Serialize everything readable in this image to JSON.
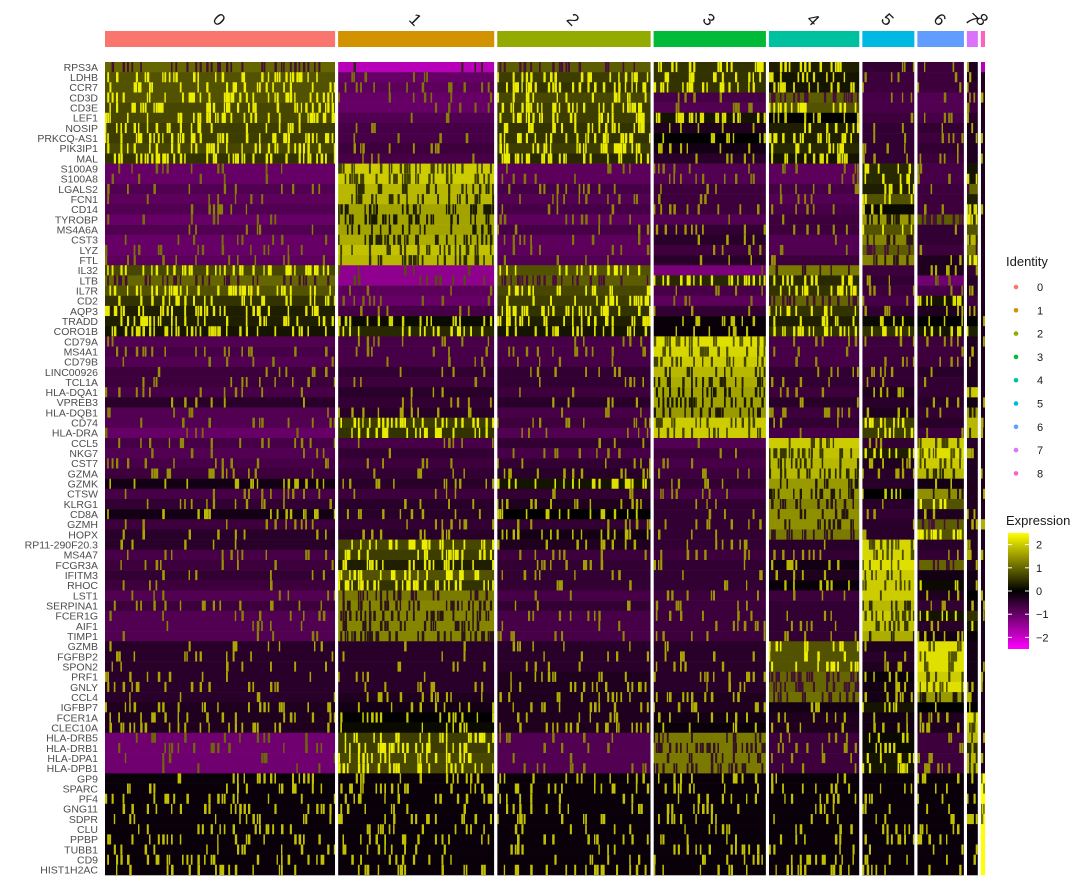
{
  "chart_data": {
    "type": "heatmap",
    "title": "",
    "xlabel": "",
    "ylabel": "",
    "clusters": [
      {
        "name": "0",
        "color": "#F8766D",
        "cells": 840
      },
      {
        "name": "1",
        "color": "#D39200",
        "cells": 570
      },
      {
        "name": "2",
        "color": "#93AA00",
        "cells": 560
      },
      {
        "name": "3",
        "color": "#00BA38",
        "cells": 410
      },
      {
        "name": "4",
        "color": "#00C19F",
        "cells": 330
      },
      {
        "name": "5",
        "color": "#00B9E3",
        "cells": 190
      },
      {
        "name": "6",
        "color": "#619CFF",
        "cells": 170
      },
      {
        "name": "7",
        "color": "#DB72FB",
        "cells": 40
      },
      {
        "name": "8",
        "color": "#FF61C3",
        "cells": 15
      }
    ],
    "genes": [
      "RPS3A",
      "LDHB",
      "CCR7",
      "CD3D",
      "CD3E",
      "LEF1",
      "NOSIP",
      "PRKCQ-AS1",
      "PIK3IP1",
      "MAL",
      "S100A9",
      "S100A8",
      "LGALS2",
      "FCN1",
      "CD14",
      "TYROBP",
      "MS4A6A",
      "CST3",
      "LYZ",
      "FTL",
      "IL32",
      "LTB",
      "IL7R",
      "CD2",
      "AQP3",
      "TRADD",
      "CORO1B",
      "CD79A",
      "MS4A1",
      "CD79B",
      "LINC00926",
      "TCL1A",
      "HLA-DQA1",
      "VPREB3",
      "HLA-DQB1",
      "CD74",
      "HLA-DRA",
      "CCL5",
      "NKG7",
      "CST7",
      "GZMA",
      "GZMK",
      "CTSW",
      "KLRG1",
      "CD8A",
      "GZMH",
      "HOPX",
      "RP11-290F20.3",
      "MS4A7",
      "FCGR3A",
      "IFITM3",
      "RHOC",
      "LST1",
      "SERPINA1",
      "FCER1G",
      "AIF1",
      "TIMP1",
      "GZMB",
      "FGFBP2",
      "SPON2",
      "PRF1",
      "GNLY",
      "CCL4",
      "IGFBP7",
      "FCER1A",
      "CLEC10A",
      "HLA-DRB5",
      "HLA-DRB1",
      "HLA-DPA1",
      "HLA-DPB1",
      "GP9",
      "SPARC",
      "PF4",
      "GNG11",
      "SDPR",
      "CLU",
      "PPBP",
      "TUBB1",
      "CD9",
      "HIST1H2AC"
    ],
    "mean_expression": {
      "0": [
        1.0,
        0.8,
        0.8,
        0.8,
        0.7,
        0.7,
        0.6,
        0.6,
        0.7,
        0.5,
        -1.0,
        -1.0,
        -0.8,
        -0.9,
        -0.8,
        -1.0,
        -0.8,
        -1.0,
        -1.0,
        -0.9,
        0.7,
        1.0,
        0.8,
        0.5,
        0.3,
        0.3,
        0.2,
        -0.8,
        -0.7,
        -0.8,
        -0.6,
        -0.6,
        -0.7,
        -0.4,
        -0.8,
        -0.8,
        -1.0,
        -0.7,
        -0.8,
        -0.7,
        -0.6,
        -0.2,
        -0.7,
        -0.5,
        -0.2,
        -0.6,
        -0.4,
        -0.4,
        -0.7,
        -0.6,
        -0.5,
        -0.6,
        -0.8,
        -0.6,
        -0.8,
        -0.8,
        -0.8,
        -0.4,
        -0.4,
        -0.4,
        -0.4,
        -0.4,
        -0.4,
        -0.3,
        -0.3,
        -0.3,
        -1.1,
        -1.1,
        -1.1,
        -1.1,
        -0.1,
        -0.1,
        -0.1,
        -0.1,
        -0.1,
        -0.1,
        -0.1,
        -0.1,
        -0.1,
        -0.1
      ],
      "1": [
        -1.8,
        -1.0,
        -0.9,
        -1.0,
        -1.0,
        -0.8,
        -0.7,
        -0.7,
        -0.6,
        -0.7,
        2.0,
        2.0,
        1.8,
        1.8,
        1.6,
        1.6,
        1.6,
        1.7,
        1.9,
        1.8,
        -1.4,
        -1.4,
        -0.9,
        -1.0,
        -0.7,
        0.1,
        0.4,
        -0.7,
        -0.7,
        -0.7,
        -0.5,
        -0.6,
        -0.4,
        -0.5,
        -0.4,
        0.6,
        0.5,
        -0.7,
        -0.5,
        -0.6,
        -0.5,
        -0.4,
        -0.6,
        -0.4,
        -0.4,
        -0.5,
        -0.4,
        0.7,
        0.6,
        0.3,
        0.8,
        0.5,
        1.2,
        1.3,
        1.3,
        1.3,
        1.3,
        -0.4,
        -0.4,
        -0.4,
        -0.4,
        -0.4,
        -0.3,
        -0.2,
        0.0,
        0.1,
        0.6,
        0.6,
        0.7,
        0.7,
        -0.1,
        -0.1,
        -0.1,
        -0.1,
        -0.1,
        -0.1,
        -0.1,
        -0.1,
        -0.1,
        -0.1
      ],
      "2": [
        0.9,
        0.6,
        0.5,
        0.7,
        0.6,
        0.6,
        0.5,
        0.5,
        0.6,
        0.4,
        -0.9,
        -0.9,
        -0.7,
        -0.8,
        -0.7,
        -0.9,
        -0.7,
        -0.9,
        -0.9,
        -0.8,
        0.8,
        0.9,
        0.7,
        0.6,
        0.5,
        0.3,
        0.2,
        -0.7,
        -0.7,
        -0.7,
        -0.5,
        -0.5,
        -0.6,
        -0.4,
        -0.7,
        -0.6,
        -0.8,
        -0.5,
        -0.7,
        -0.5,
        -0.4,
        0.2,
        -0.5,
        -0.3,
        0.0,
        -0.5,
        -0.2,
        -0.3,
        -0.6,
        -0.5,
        -0.5,
        -0.5,
        -0.7,
        -0.5,
        -0.7,
        -0.7,
        -0.7,
        -0.4,
        -0.4,
        -0.4,
        -0.3,
        -0.3,
        -0.3,
        -0.3,
        -0.3,
        -0.3,
        -0.8,
        -0.8,
        -0.8,
        -0.8,
        -0.1,
        -0.1,
        -0.1,
        -0.1,
        -0.1,
        -0.1,
        -0.1,
        -0.1,
        -0.1,
        -0.1
      ],
      "3": [
        0.5,
        0.5,
        0.5,
        -0.7,
        -0.8,
        0.2,
        -0.3,
        0.0,
        -0.2,
        -0.4,
        -0.8,
        -0.8,
        -0.6,
        -0.6,
        -0.6,
        -0.8,
        -0.5,
        -0.4,
        -0.6,
        -0.4,
        -1.2,
        0.4,
        -0.7,
        -0.9,
        -0.5,
        -0.1,
        -0.1,
        2.2,
        2.1,
        2.0,
        1.8,
        1.7,
        1.6,
        1.6,
        1.5,
        2.0,
        2.0,
        -0.8,
        -0.6,
        -0.7,
        -0.6,
        -0.5,
        -0.7,
        -0.5,
        -0.5,
        -0.5,
        -0.5,
        -0.5,
        -0.6,
        -0.5,
        -0.5,
        -0.5,
        -0.6,
        -0.6,
        -0.6,
        -0.6,
        -0.6,
        -0.4,
        -0.4,
        -0.4,
        -0.4,
        -0.4,
        -0.3,
        -0.3,
        -0.2,
        -0.1,
        1.2,
        1.2,
        1.2,
        1.2,
        -0.1,
        -0.1,
        -0.1,
        -0.1,
        -0.1,
        -0.1,
        -0.1,
        -0.1,
        -0.1,
        -0.1
      ],
      "4": [
        0.3,
        0.2,
        0.2,
        0.9,
        0.8,
        0.0,
        0.3,
        0.3,
        0.4,
        0.2,
        -0.9,
        -0.9,
        -0.7,
        -0.8,
        -0.7,
        -0.6,
        -0.6,
        -0.8,
        -0.8,
        -0.6,
        1.2,
        0.4,
        0.5,
        1.0,
        0.5,
        0.3,
        0.5,
        -0.7,
        -0.7,
        -0.7,
        -0.5,
        -0.5,
        -0.6,
        -0.4,
        -0.6,
        -0.5,
        -0.7,
        2.0,
        1.9,
        1.8,
        1.8,
        1.5,
        1.5,
        1.3,
        1.4,
        1.4,
        1.2,
        -0.4,
        -0.5,
        -0.2,
        -0.3,
        -0.1,
        -0.6,
        -0.5,
        -0.5,
        -0.5,
        -0.5,
        0.8,
        0.8,
        0.8,
        1.0,
        1.0,
        1.1,
        -0.2,
        -0.3,
        -0.3,
        -0.6,
        -0.6,
        -0.6,
        -0.6,
        -0.1,
        -0.1,
        -0.1,
        -0.1,
        -0.1,
        -0.1,
        -0.1,
        -0.1,
        -0.1,
        -0.1
      ],
      "5": [
        -0.5,
        -0.6,
        -0.6,
        -0.7,
        -0.7,
        -0.6,
        -0.5,
        -0.5,
        -0.5,
        -0.5,
        0.4,
        0.4,
        0.3,
        0.8,
        0.1,
        1.5,
        0.8,
        1.3,
        0.9,
        1.3,
        -0.6,
        -0.5,
        -0.6,
        -0.7,
        -0.5,
        0.1,
        0.5,
        -0.6,
        -0.6,
        -0.6,
        -0.5,
        -0.5,
        -0.3,
        -0.4,
        -0.3,
        0.6,
        0.6,
        -0.5,
        0.3,
        -0.3,
        -0.4,
        -0.4,
        0.0,
        -0.4,
        -0.5,
        -0.4,
        -0.4,
        2.1,
        2.1,
        2.2,
        2.0,
        2.0,
        2.0,
        1.8,
        2.0,
        1.9,
        1.7,
        -0.3,
        -0.4,
        -0.3,
        -0.1,
        -0.2,
        -0.2,
        0.2,
        -0.2,
        -0.2,
        0.1,
        0.1,
        0.2,
        0.2,
        -0.1,
        -0.1,
        -0.1,
        -0.1,
        -0.1,
        -0.1,
        -0.1,
        -0.1,
        -0.1,
        -0.1
      ],
      "6": [
        -0.6,
        -0.6,
        -0.6,
        -0.8,
        -0.8,
        -0.7,
        -0.5,
        -0.6,
        -0.5,
        -0.6,
        -0.7,
        -0.7,
        -0.6,
        -0.6,
        -0.6,
        0.9,
        -0.5,
        -0.5,
        -0.6,
        -0.3,
        -0.3,
        -1.1,
        -0.7,
        0.2,
        -0.3,
        0.0,
        0.2,
        -0.6,
        -0.6,
        -0.6,
        -0.4,
        -0.5,
        -0.5,
        -0.4,
        -0.5,
        -0.4,
        -0.6,
        2.0,
        2.2,
        2.0,
        1.8,
        -0.2,
        1.4,
        0.8,
        -0.3,
        0.9,
        0.8,
        -0.4,
        -0.5,
        1.0,
        -0.2,
        0.1,
        -0.3,
        -0.5,
        0.2,
        -0.4,
        -0.2,
        2.2,
        2.2,
        2.2,
        2.0,
        2.2,
        1.5,
        0.0,
        -0.3,
        -0.3,
        -0.6,
        -0.6,
        -0.6,
        -0.6,
        -0.1,
        -0.1,
        -0.1,
        -0.1,
        -0.1,
        -0.1,
        -0.1,
        -0.1,
        -0.1,
        -0.1
      ],
      "7": [
        -0.3,
        -0.3,
        -0.4,
        -0.6,
        -0.6,
        -0.4,
        -0.3,
        -0.3,
        -0.3,
        -0.3,
        0.2,
        0.2,
        1.0,
        0.3,
        0.2,
        0.5,
        0.8,
        1.8,
        1.2,
        0.8,
        -0.5,
        -0.4,
        -0.4,
        -0.6,
        -0.3,
        0.0,
        0.3,
        -0.3,
        -0.3,
        -0.3,
        -0.3,
        -0.3,
        2.0,
        -0.2,
        1.5,
        1.8,
        1.8,
        -0.4,
        -0.3,
        -0.3,
        -0.3,
        -0.3,
        -0.3,
        -0.3,
        -0.3,
        -0.3,
        -0.3,
        -0.3,
        -0.3,
        -0.3,
        -0.2,
        -0.2,
        0.0,
        -0.2,
        0.5,
        0.2,
        -0.1,
        -0.2,
        -0.2,
        -0.2,
        -0.2,
        -0.2,
        -0.2,
        0.0,
        2.2,
        2.0,
        1.8,
        1.8,
        1.8,
        1.8,
        -0.1,
        -0.1,
        -0.1,
        -0.1,
        -0.1,
        -0.1,
        -0.1,
        -0.1,
        -0.1,
        -0.1
      ],
      "8": [
        -1.8,
        -0.3,
        -0.3,
        -0.3,
        -0.3,
        -0.3,
        -0.3,
        -0.3,
        -0.3,
        -0.3,
        -0.3,
        -0.3,
        -0.3,
        -0.3,
        -0.3,
        -0.3,
        -0.3,
        -0.3,
        -0.3,
        -0.3,
        -0.3,
        -0.3,
        -0.3,
        -0.3,
        -0.3,
        -0.3,
        -0.3,
        -0.3,
        -0.3,
        -0.3,
        -0.3,
        -0.3,
        -0.3,
        -0.3,
        -0.3,
        -0.3,
        -0.3,
        -0.3,
        -0.3,
        -0.3,
        -0.3,
        -0.3,
        -0.3,
        -0.3,
        -0.3,
        -0.3,
        -0.3,
        -0.3,
        -0.3,
        -0.3,
        -0.3,
        -0.3,
        -0.3,
        -0.3,
        -0.3,
        -0.3,
        -0.3,
        -0.3,
        -0.3,
        -0.3,
        -0.3,
        -0.3,
        -0.3,
        -0.3,
        -0.3,
        -0.3,
        -0.3,
        -0.3,
        -0.3,
        -0.3,
        2.5,
        2.5,
        2.5,
        2.5,
        2.5,
        2.5,
        2.5,
        2.5,
        2.5,
        2.5
      ]
    },
    "color_scale": {
      "low": "#FF00FF",
      "mid": "#000000",
      "high": "#FFFF00",
      "limits": [
        -2.5,
        2.5
      ],
      "ticks": [
        2,
        1,
        0,
        -1,
        -2
      ],
      "tick_labels": [
        "2",
        "1",
        "0",
        "−1",
        "−2"
      ]
    },
    "legend_identity": {
      "title": "Identity",
      "items": [
        "0",
        "1",
        "2",
        "3",
        "4",
        "5",
        "6",
        "7",
        "8"
      ],
      "position": "right"
    },
    "legend_expression": {
      "title": "Expression",
      "position": "right"
    },
    "grid": false
  }
}
